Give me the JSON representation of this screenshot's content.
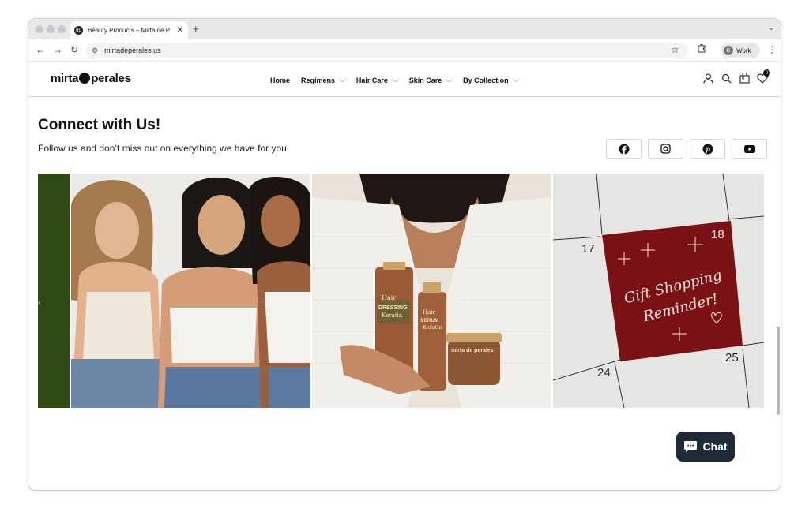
{
  "browser": {
    "tab_title": "Beauty Products – Mirta de P",
    "tab_favicon_text": "dp",
    "url": "mirtadeperales.us",
    "profile_initial": "K",
    "profile_name": "Work"
  },
  "site": {
    "logo_part1": "mirta",
    "logo_mid": "de",
    "logo_part2": "perales",
    "nav": [
      {
        "label": "Home",
        "has_dropdown": false
      },
      {
        "label": "Regimens",
        "has_dropdown": true
      },
      {
        "label": "Hair Care",
        "has_dropdown": true
      },
      {
        "label": "Skin Care",
        "has_dropdown": true
      },
      {
        "label": "By Collection",
        "has_dropdown": true
      }
    ],
    "cart_count": "0",
    "wishlist_count": "0"
  },
  "connect": {
    "title": "Connect with Us!",
    "subtitle": "Follow us and don’t miss out on everything we have for you.",
    "socials": [
      "facebook-icon",
      "instagram-icon",
      "pinterest-icon",
      "youtube-icon"
    ]
  },
  "gallery": {
    "products": {
      "bottle1_line1": "Hair",
      "bottle1_line2": "DRESSING",
      "bottle1_line3": "Keratin",
      "bottle2_line1": "Hair",
      "bottle2_line2": "SERUM",
      "bottle2_line3": "Keratin",
      "jar_label": "mirta de perales"
    },
    "calendar": {
      "day_a": "17",
      "day_b": "18",
      "day_c": "24",
      "day_d": "25",
      "card_line1": "Gift Shopping",
      "card_line2": "Reminder!"
    }
  },
  "chat": {
    "label": "Chat"
  },
  "colors": {
    "chat_bg": "#1e2a38",
    "calendar_card": "#7a1215",
    "green_strip": "#2f4a12"
  }
}
